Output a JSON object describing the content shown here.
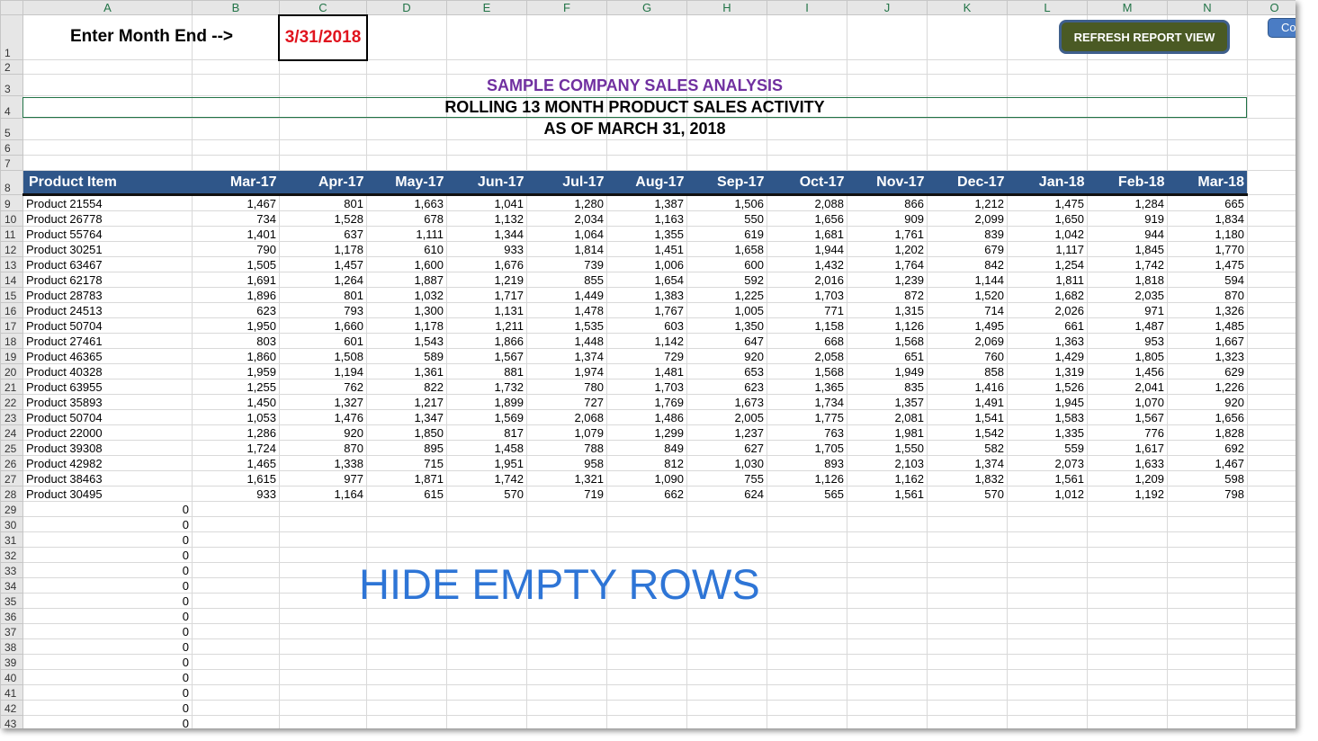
{
  "columns": [
    "A",
    "B",
    "C",
    "D",
    "E",
    "F",
    "G",
    "H",
    "I",
    "J",
    "K",
    "L",
    "M",
    "N",
    "O"
  ],
  "month_end": {
    "label": "Enter Month End -->",
    "value": "3/31/2018",
    "value_color": "#e0141e"
  },
  "refresh_button": {
    "label": "REFRESH REPORT VIEW",
    "color": "#4a5a24"
  },
  "side_button": {
    "label": "Co"
  },
  "titles": {
    "company": "SAMPLE COMPANY SALES ANALYSIS",
    "report": "ROLLING 13 MONTH PRODUCT SALES ACTIVITY",
    "as_of": "AS OF MARCH 31, 2018"
  },
  "table": {
    "header_color": "#2f5689",
    "first_header": "Product Item",
    "months": [
      "Mar-17",
      "Apr-17",
      "May-17",
      "Jun-17",
      "Jul-17",
      "Aug-17",
      "Sep-17",
      "Oct-17",
      "Nov-17",
      "Dec-17",
      "Jan-18",
      "Feb-18",
      "Mar-18"
    ],
    "rows": [
      {
        "product": "Product 21554",
        "values": [
          "1,467",
          "801",
          "1,663",
          "1,041",
          "1,280",
          "1,387",
          "1,506",
          "2,088",
          "866",
          "1,212",
          "1,475",
          "1,284",
          "665"
        ]
      },
      {
        "product": "Product 26778",
        "values": [
          "734",
          "1,528",
          "678",
          "1,132",
          "2,034",
          "1,163",
          "550",
          "1,656",
          "909",
          "2,099",
          "1,650",
          "919",
          "1,834"
        ]
      },
      {
        "product": "Product 55764",
        "values": [
          "1,401",
          "637",
          "1,111",
          "1,344",
          "1,064",
          "1,355",
          "619",
          "1,681",
          "1,761",
          "839",
          "1,042",
          "944",
          "1,180"
        ]
      },
      {
        "product": "Product 30251",
        "values": [
          "790",
          "1,178",
          "610",
          "933",
          "1,814",
          "1,451",
          "1,658",
          "1,944",
          "1,202",
          "679",
          "1,117",
          "1,845",
          "1,770"
        ]
      },
      {
        "product": "Product 63467",
        "values": [
          "1,505",
          "1,457",
          "1,600",
          "1,676",
          "739",
          "1,006",
          "600",
          "1,432",
          "1,764",
          "842",
          "1,254",
          "1,742",
          "1,475"
        ]
      },
      {
        "product": "Product 62178",
        "values": [
          "1,691",
          "1,264",
          "1,887",
          "1,219",
          "855",
          "1,654",
          "592",
          "2,016",
          "1,239",
          "1,144",
          "1,811",
          "1,818",
          "594"
        ]
      },
      {
        "product": "Product 28783",
        "values": [
          "1,896",
          "801",
          "1,032",
          "1,717",
          "1,449",
          "1,383",
          "1,225",
          "1,703",
          "872",
          "1,520",
          "1,682",
          "2,035",
          "870"
        ]
      },
      {
        "product": "Product 24513",
        "values": [
          "623",
          "793",
          "1,300",
          "1,131",
          "1,478",
          "1,767",
          "1,005",
          "771",
          "1,315",
          "714",
          "2,026",
          "971",
          "1,326"
        ]
      },
      {
        "product": "Product 50704",
        "values": [
          "1,950",
          "1,660",
          "1,178",
          "1,211",
          "1,535",
          "603",
          "1,350",
          "1,158",
          "1,126",
          "1,495",
          "661",
          "1,487",
          "1,485"
        ]
      },
      {
        "product": "Product 27461",
        "values": [
          "803",
          "601",
          "1,543",
          "1,866",
          "1,448",
          "1,142",
          "647",
          "668",
          "1,568",
          "2,069",
          "1,363",
          "953",
          "1,667"
        ]
      },
      {
        "product": "Product 46365",
        "values": [
          "1,860",
          "1,508",
          "589",
          "1,567",
          "1,374",
          "729",
          "920",
          "2,058",
          "651",
          "760",
          "1,429",
          "1,805",
          "1,323"
        ]
      },
      {
        "product": "Product 40328",
        "values": [
          "1,959",
          "1,194",
          "1,361",
          "881",
          "1,974",
          "1,481",
          "653",
          "1,568",
          "1,949",
          "858",
          "1,319",
          "1,456",
          "629"
        ]
      },
      {
        "product": "Product 63955",
        "values": [
          "1,255",
          "762",
          "822",
          "1,732",
          "780",
          "1,703",
          "623",
          "1,365",
          "835",
          "1,416",
          "1,526",
          "2,041",
          "1,226"
        ]
      },
      {
        "product": "Product 35893",
        "values": [
          "1,450",
          "1,327",
          "1,217",
          "1,899",
          "727",
          "1,769",
          "1,673",
          "1,734",
          "1,357",
          "1,491",
          "1,945",
          "1,070",
          "920"
        ]
      },
      {
        "product": "Product 50704",
        "values": [
          "1,053",
          "1,476",
          "1,347",
          "1,569",
          "2,068",
          "1,486",
          "2,005",
          "1,775",
          "2,081",
          "1,541",
          "1,583",
          "1,567",
          "1,656"
        ]
      },
      {
        "product": "Product 22000",
        "values": [
          "1,286",
          "920",
          "1,850",
          "817",
          "1,079",
          "1,299",
          "1,237",
          "763",
          "1,981",
          "1,542",
          "1,335",
          "776",
          "1,828"
        ]
      },
      {
        "product": "Product 39308",
        "values": [
          "1,724",
          "870",
          "895",
          "1,458",
          "788",
          "849",
          "627",
          "1,705",
          "1,550",
          "582",
          "559",
          "1,617",
          "692"
        ]
      },
      {
        "product": "Product 42982",
        "values": [
          "1,465",
          "1,338",
          "715",
          "1,951",
          "958",
          "812",
          "1,030",
          "893",
          "2,103",
          "1,374",
          "2,073",
          "1,633",
          "1,467"
        ]
      },
      {
        "product": "Product 38463",
        "values": [
          "1,615",
          "977",
          "1,871",
          "1,742",
          "1,321",
          "1,090",
          "755",
          "1,126",
          "1,162",
          "1,832",
          "1,561",
          "1,209",
          "598"
        ]
      },
      {
        "product": "Product 30495",
        "values": [
          "933",
          "1,164",
          "615",
          "570",
          "719",
          "662",
          "624",
          "565",
          "1,561",
          "570",
          "1,012",
          "1,192",
          "798"
        ]
      }
    ],
    "empty_rows_value": "0"
  },
  "annotation": {
    "text": "HIDE EMPTY ROWS",
    "color": "#2e75d6"
  }
}
